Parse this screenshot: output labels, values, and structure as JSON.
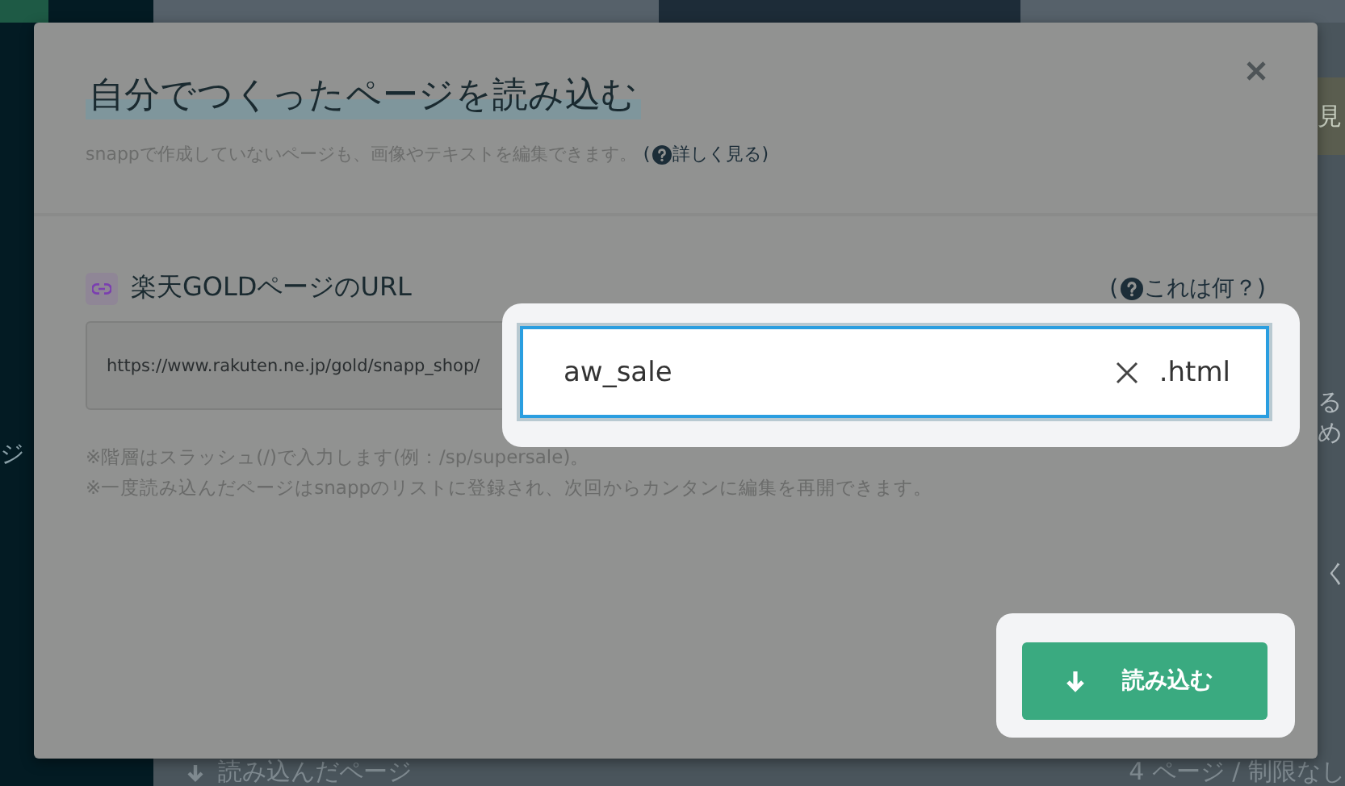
{
  "background": {
    "left_fragment": "ジ",
    "right_fragments": [
      "見",
      "る",
      "め",
      "く"
    ],
    "bottom_left": "読み込んだページ",
    "bottom_right": "4 ページ / 制限なし"
  },
  "dialog": {
    "title": "自分でつくったページを読み込む",
    "subtitle": "snappで作成していないページも、画像やテキストを編集できます。",
    "help_link": {
      "open": "(",
      "label": "詳しく見る",
      "close": ")"
    },
    "field_label": "楽天GOLDページのURL",
    "field_help": {
      "open": "(",
      "label": "これは何？",
      "close": ")"
    },
    "url_prefix": "https://www.rakuten.ne.jp/gold/snapp_shop/",
    "url_value": "aw_sale",
    "url_suffix": ".html",
    "notes": [
      "※階層はスラッシュ(/)で入力します(例：/sp/supersale)。",
      "※一度読み込んだページはsnappのリストに登録され、次回からカンタンに編集を再開できます。"
    ],
    "submit_button": "読み込む"
  }
}
